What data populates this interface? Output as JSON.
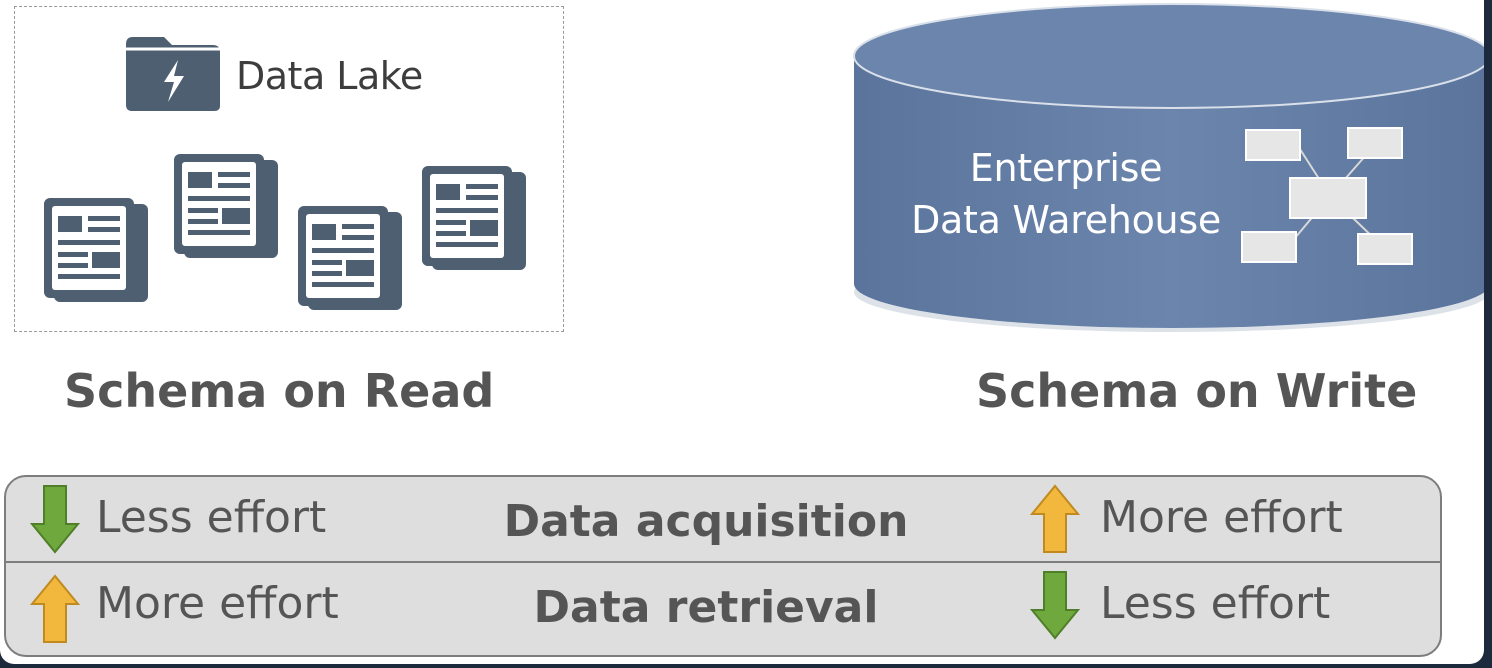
{
  "data_lake": {
    "label": "Data Lake",
    "icon": "folder-lightning-icon",
    "documents_icon": "document-icon"
  },
  "warehouse": {
    "line1": "Enterprise",
    "line2": "Data Warehouse",
    "icon": "database-cylinder-icon",
    "schema_icon": "table-relationship-icon"
  },
  "headings": {
    "read": "Schema on Read",
    "write": "Schema on Write"
  },
  "comparison": {
    "rows": [
      {
        "left": "Less effort",
        "left_arrow": "down",
        "center": "Data acquisition",
        "right": "More effort",
        "right_arrow": "up"
      },
      {
        "left": "More effort",
        "left_arrow": "up",
        "center": "Data retrieval",
        "right": "Less effort",
        "right_arrow": "down"
      }
    ]
  },
  "colors": {
    "cylinder": "#6b85ad",
    "icon_slate": "#4f5f72",
    "arrow_down": "#6fa83c",
    "arrow_up": "#f2b73d",
    "table_bg": "#dedede"
  }
}
